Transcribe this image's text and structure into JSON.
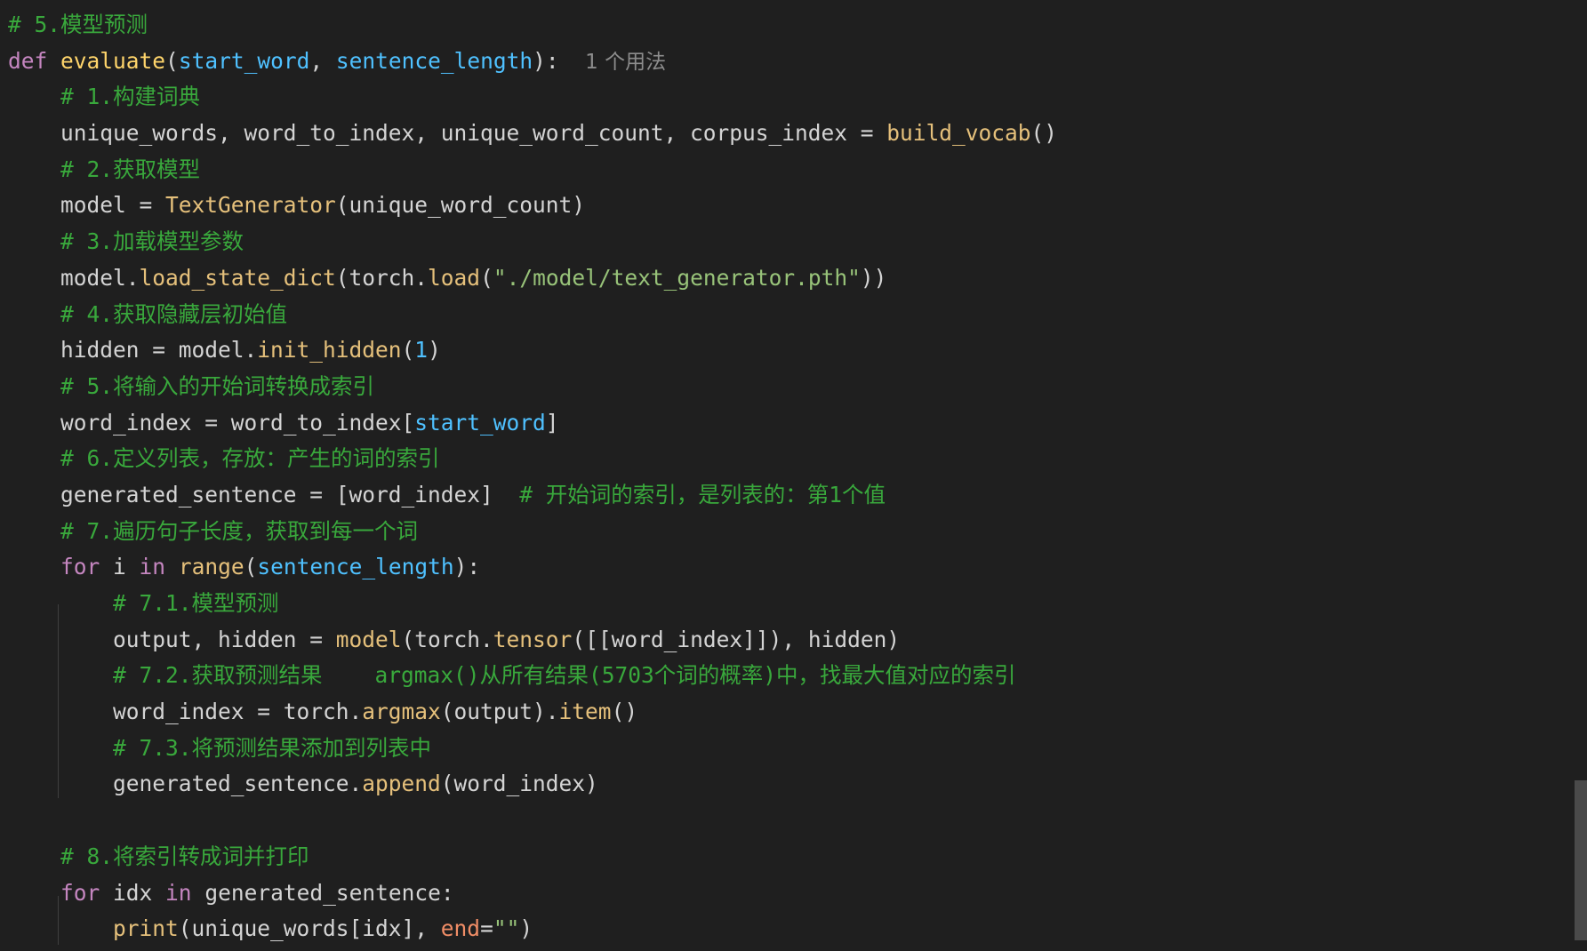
{
  "lines": [
    [
      {
        "t": "# 5.模型预测",
        "c": "cm"
      }
    ],
    [
      {
        "t": "def",
        "c": "kw"
      },
      {
        "t": " "
      },
      {
        "t": "evaluate",
        "c": "fn-def"
      },
      {
        "t": "("
      },
      {
        "t": "start_word",
        "c": "param"
      },
      {
        "t": ", "
      },
      {
        "t": "sentence_length",
        "c": "param"
      },
      {
        "t": "):  "
      },
      {
        "t": "1 个用法",
        "c": "hint"
      }
    ],
    [
      {
        "t": "    "
      },
      {
        "t": "# 1.构建词典",
        "c": "cm"
      }
    ],
    [
      {
        "t": "    unique_words, word_to_index, unique_word_count, corpus_index = "
      },
      {
        "t": "build_vocab",
        "c": "fn"
      },
      {
        "t": "()"
      }
    ],
    [
      {
        "t": "    "
      },
      {
        "t": "# 2.获取模型",
        "c": "cm"
      }
    ],
    [
      {
        "t": "    model = "
      },
      {
        "t": "TextGenerator",
        "c": "fn"
      },
      {
        "t": "(unique_word_count)"
      }
    ],
    [
      {
        "t": "    "
      },
      {
        "t": "# 3.加载模型参数",
        "c": "cm"
      }
    ],
    [
      {
        "t": "    model."
      },
      {
        "t": "load_state_dict",
        "c": "fn"
      },
      {
        "t": "(torch."
      },
      {
        "t": "load",
        "c": "fn"
      },
      {
        "t": "("
      },
      {
        "t": "\"./model/text_generator.pth\"",
        "c": "str"
      },
      {
        "t": "))"
      }
    ],
    [
      {
        "t": "    "
      },
      {
        "t": "# 4.获取隐藏层初始值",
        "c": "cm"
      }
    ],
    [
      {
        "t": "    hidden = model."
      },
      {
        "t": "init_hidden",
        "c": "fn"
      },
      {
        "t": "("
      },
      {
        "t": "1",
        "c": "num"
      },
      {
        "t": ")"
      }
    ],
    [
      {
        "t": "    "
      },
      {
        "t": "# 5.将输入的开始词转换成索引",
        "c": "cm"
      }
    ],
    [
      {
        "t": "    word_index = word_to_index["
      },
      {
        "t": "start_word",
        "c": "param"
      },
      {
        "t": "]"
      }
    ],
    [
      {
        "t": "    "
      },
      {
        "t": "# 6.定义列表，存放：产生的词的索引",
        "c": "cm"
      }
    ],
    [
      {
        "t": "    generated_sentence = [word_index]  "
      },
      {
        "t": "# 开始词的索引，是列表的：第1个值",
        "c": "cm"
      }
    ],
    [
      {
        "t": "    "
      },
      {
        "t": "# 7.遍历句子长度，获取到每一个词",
        "c": "cm"
      }
    ],
    [
      {
        "t": "    "
      },
      {
        "t": "for",
        "c": "kw"
      },
      {
        "t": " i "
      },
      {
        "t": "in",
        "c": "kw"
      },
      {
        "t": " "
      },
      {
        "t": "range",
        "c": "fn"
      },
      {
        "t": "("
      },
      {
        "t": "sentence_length",
        "c": "param"
      },
      {
        "t": "):"
      }
    ],
    [
      {
        "t": "        "
      },
      {
        "t": "# 7.1.模型预测",
        "c": "cm"
      }
    ],
    [
      {
        "t": "        output, hidden = "
      },
      {
        "t": "model",
        "c": "fn"
      },
      {
        "t": "(torch."
      },
      {
        "t": "tensor",
        "c": "fn"
      },
      {
        "t": "([[word_index]]), hidden)"
      }
    ],
    [
      {
        "t": "        "
      },
      {
        "t": "# 7.2.获取预测结果    argmax()从所有结果(5703个词的概率)中，找最大值对应的索引",
        "c": "cm"
      }
    ],
    [
      {
        "t": "        word_index = torch."
      },
      {
        "t": "argmax",
        "c": "fn"
      },
      {
        "t": "(output)."
      },
      {
        "t": "item",
        "c": "fn"
      },
      {
        "t": "()"
      }
    ],
    [
      {
        "t": "        "
      },
      {
        "t": "# 7.3.将预测结果添加到列表中",
        "c": "cm"
      }
    ],
    [
      {
        "t": "        generated_sentence."
      },
      {
        "t": "append",
        "c": "fn"
      },
      {
        "t": "(word_index)"
      }
    ],
    [
      {
        "t": ""
      }
    ],
    [
      {
        "t": "    "
      },
      {
        "t": "# 8.将索引转成词并打印",
        "c": "cm"
      }
    ],
    [
      {
        "t": "    "
      },
      {
        "t": "for",
        "c": "kw"
      },
      {
        "t": " idx "
      },
      {
        "t": "in",
        "c": "kw"
      },
      {
        "t": " generated_sentence:"
      }
    ],
    [
      {
        "t": "        "
      },
      {
        "t": "print",
        "c": "fn"
      },
      {
        "t": "(unique_words[idx], "
      },
      {
        "t": "end",
        "c": "kwarg"
      },
      {
        "t": "="
      },
      {
        "t": "\"\"",
        "c": "str"
      },
      {
        "t": ")"
      }
    ]
  ]
}
